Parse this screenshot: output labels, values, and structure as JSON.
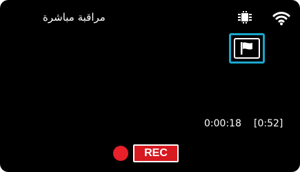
{
  "header": {
    "title": "مراقبة مباشرة",
    "icons": [
      "chip-icon",
      "wifi-icon"
    ]
  },
  "flag_button": {
    "icon": "flag-icon"
  },
  "timecode": {
    "elapsed": "0:00:18",
    "remaining": "[0:52]"
  },
  "record": {
    "dot_icon": "record-dot-icon",
    "label": "REC"
  },
  "colors": {
    "background": "#000000",
    "text": "#ffffff",
    "accent": "#1aa6cc",
    "record_red": "#d71920"
  }
}
